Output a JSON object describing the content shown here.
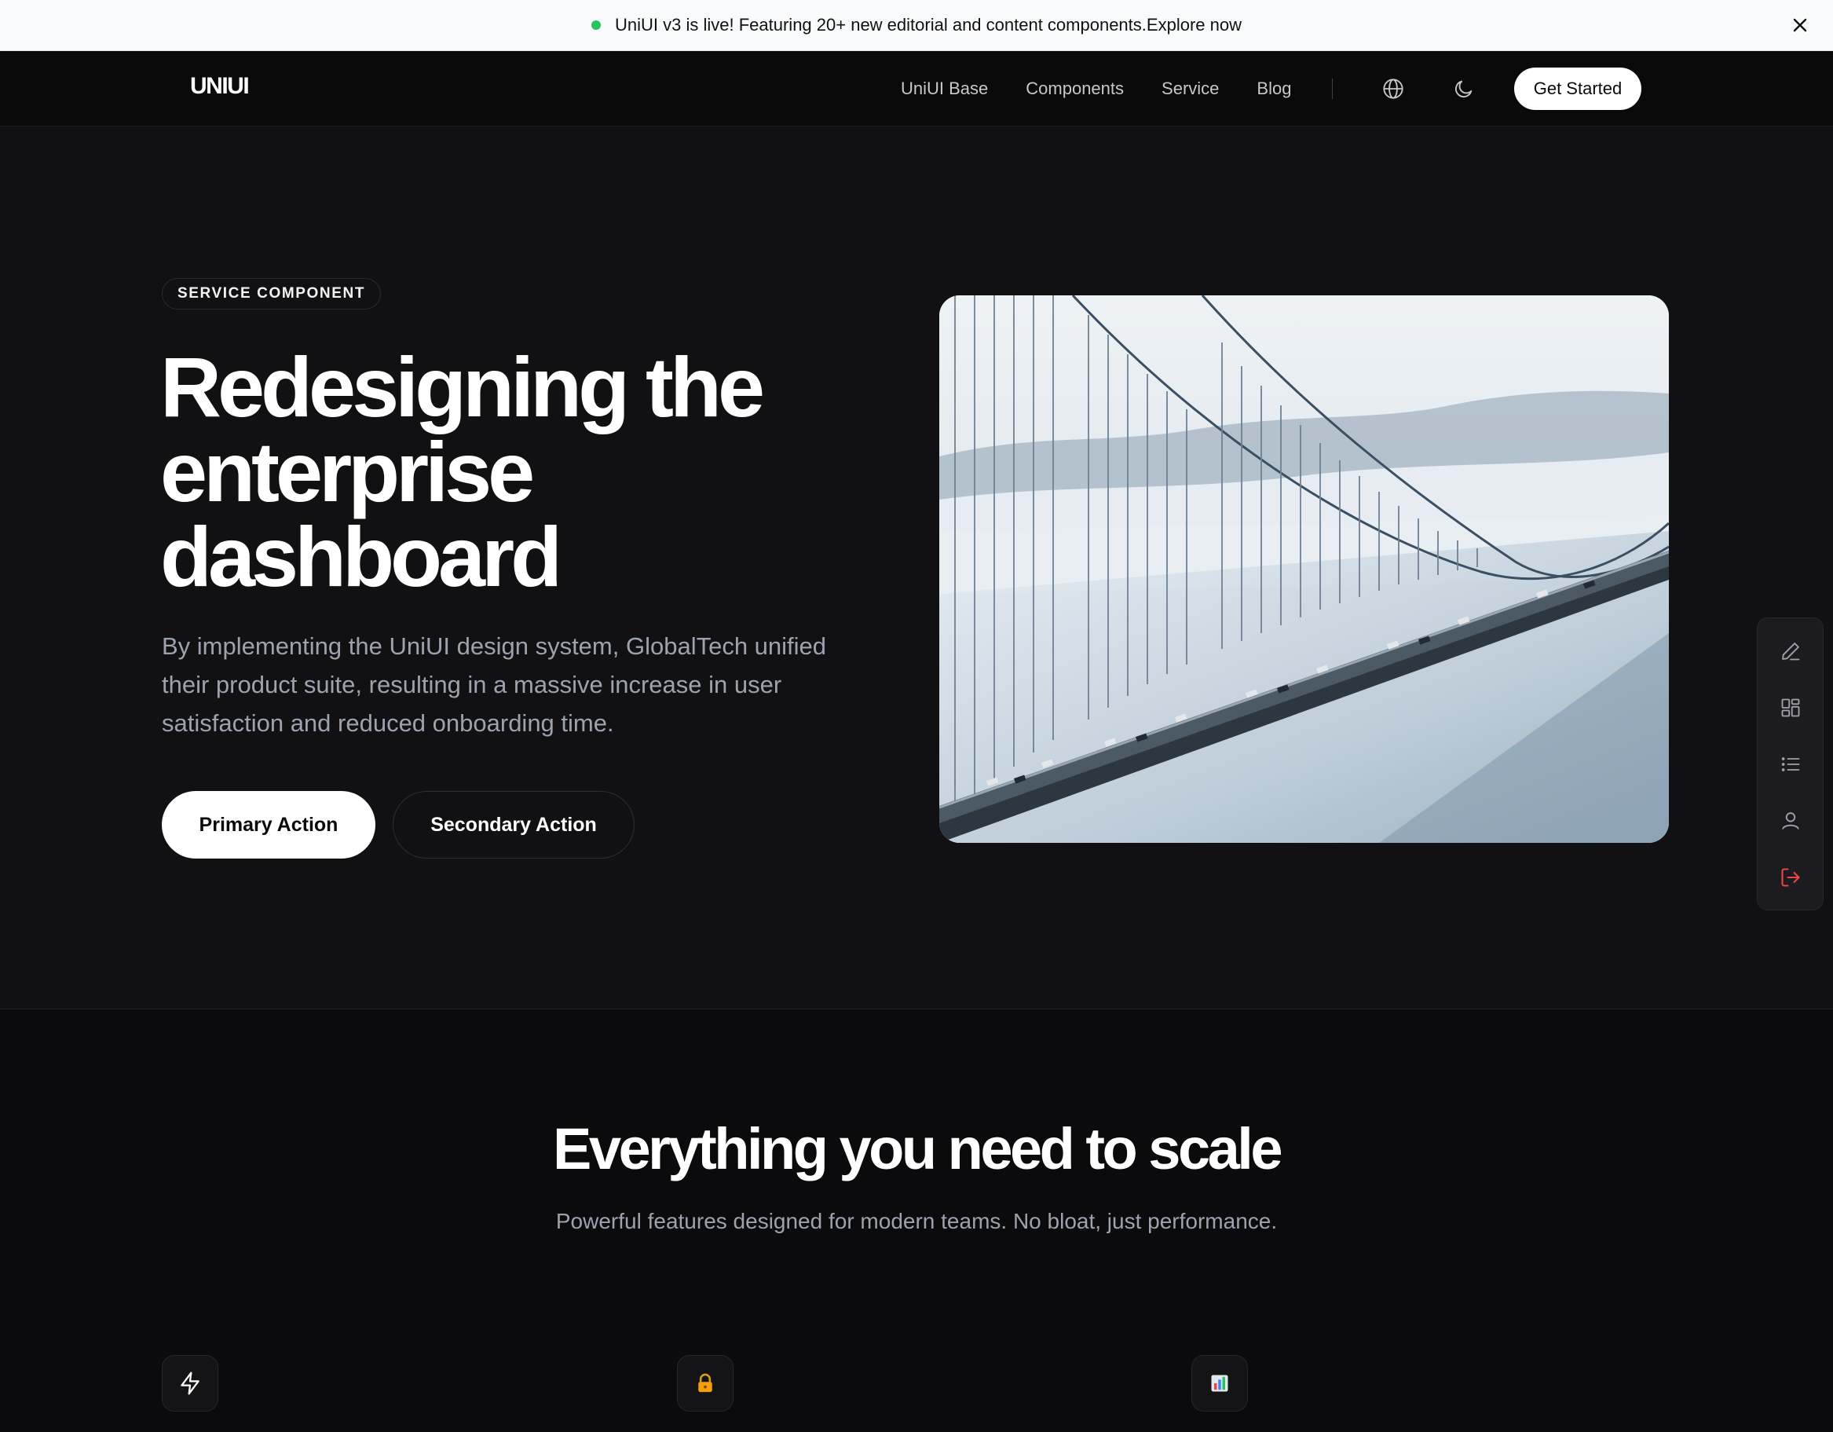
{
  "announcement": {
    "text": "UniUI v3 is live! Featuring 20+ new editorial and content components.",
    "link": "Explore now",
    "status_color": "#22c55e",
    "close_icon": "close-icon"
  },
  "nav": {
    "logo": "UNIUI",
    "links": [
      "UniUI Base",
      "Components",
      "Service",
      "Blog"
    ],
    "icons": [
      "globe-icon",
      "moon-icon"
    ],
    "cta": "Get Started"
  },
  "hero": {
    "badge": "SERVICE COMPONENT",
    "title_lines": [
      "Redesigning the",
      "enterprise",
      "dashboard"
    ],
    "description": "By implementing the UniUI design system, GlobalTech unified their product suite, resulting in a massive increase in user satisfaction and reduced onboarding time.",
    "primary_action": "Primary Action",
    "secondary_action": "Secondary Action",
    "image": "suspension-bridge-in-fog-photo"
  },
  "toolbar": {
    "items": [
      "pencil-icon",
      "layout-grid-icon",
      "list-icon",
      "user-icon",
      "logout-icon"
    ],
    "danger_color": "#ef4444"
  },
  "features": {
    "title": "Everything you need to scale",
    "subtitle": "Powerful features designed for modern teams. No bloat, just performance.",
    "icons": [
      "lightning-icon",
      "lock-icon",
      "chart-icon"
    ]
  }
}
